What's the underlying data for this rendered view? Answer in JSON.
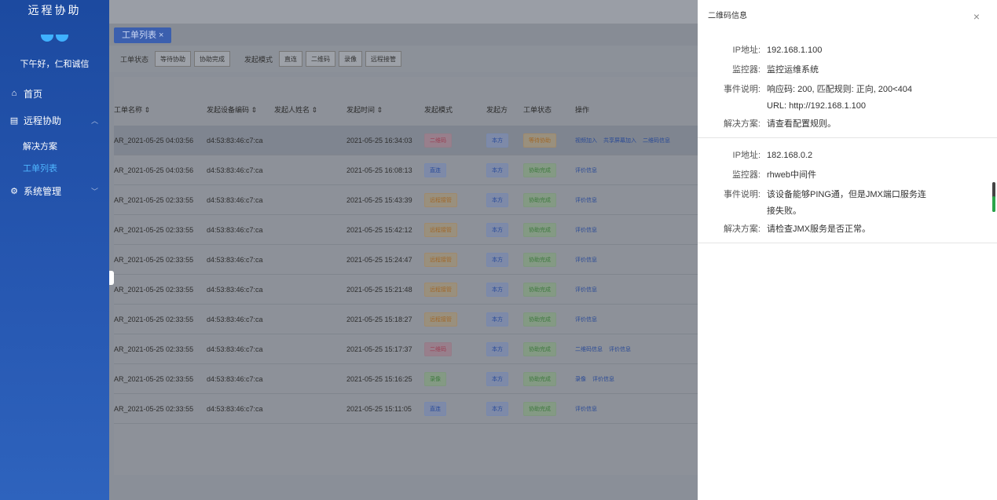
{
  "sidebar": {
    "brand": "远程协助",
    "greeting": "下午好，仁和诚信",
    "items": [
      {
        "label": "首页",
        "icon": "home-icon"
      },
      {
        "label": "远程协助",
        "icon": "clipboard-icon"
      },
      {
        "label": "系统管理",
        "icon": "gear-icon"
      }
    ],
    "subitems": [
      {
        "label": "解决方案"
      },
      {
        "label": "工单列表"
      }
    ]
  },
  "tab": {
    "label": "工单列表 ×"
  },
  "filters": {
    "status_label": "工单状态",
    "status_options": [
      "等待协助",
      "协助完成"
    ],
    "mode_label": "发起模式",
    "mode_options": [
      "直连",
      "二维码",
      "录像",
      "远程接管"
    ]
  },
  "table": {
    "headers": [
      "工单名称 ⇕",
      "发起设备编码 ⇕",
      "发起人姓名 ⇕",
      "发起时间 ⇕",
      "发起模式",
      "发起方",
      "工单状态",
      "操作"
    ],
    "rows": [
      {
        "name": "AR_2021-05-25 04:03:56",
        "device": "d4:53:83:46:c7:ca",
        "person": "",
        "time": "2021-05-25 16:34:03",
        "mode": "二维码",
        "mode_color": "red",
        "side": "本方",
        "status": "等待协助",
        "status_color": "orange",
        "ops": [
          "视频加入",
          "共享屏幕加入",
          "二维码信息"
        ]
      },
      {
        "name": "AR_2021-05-25 04:03:56",
        "device": "d4:53:83:46:c7:ca",
        "person": "",
        "time": "2021-05-25 16:08:13",
        "mode": "直连",
        "mode_color": "blue",
        "side": "本方",
        "status": "协助完成",
        "status_color": "green",
        "ops": [
          "评价信息"
        ]
      },
      {
        "name": "AR_2021-05-25 02:33:55",
        "device": "d4:53:83:46:c7:ca",
        "person": "",
        "time": "2021-05-25 15:43:39",
        "mode": "远程接管",
        "mode_color": "orange",
        "side": "本方",
        "status": "协助完成",
        "status_color": "green",
        "ops": [
          "评价信息"
        ]
      },
      {
        "name": "AR_2021-05-25 02:33:55",
        "device": "d4:53:83:46:c7:ca",
        "person": "",
        "time": "2021-05-25 15:42:12",
        "mode": "远程接管",
        "mode_color": "orange",
        "side": "本方",
        "status": "协助完成",
        "status_color": "green",
        "ops": [
          "评价信息"
        ]
      },
      {
        "name": "AR_2021-05-25 02:33:55",
        "device": "d4:53:83:46:c7:ca",
        "person": "",
        "time": "2021-05-25 15:24:47",
        "mode": "远程接管",
        "mode_color": "orange",
        "side": "本方",
        "status": "协助完成",
        "status_color": "green",
        "ops": [
          "评价信息"
        ]
      },
      {
        "name": "AR_2021-05-25 02:33:55",
        "device": "d4:53:83:46:c7:ca",
        "person": "",
        "time": "2021-05-25 15:21:48",
        "mode": "远程接管",
        "mode_color": "orange",
        "side": "本方",
        "status": "协助完成",
        "status_color": "green",
        "ops": [
          "评价信息"
        ]
      },
      {
        "name": "AR_2021-05-25 02:33:55",
        "device": "d4:53:83:46:c7:ca",
        "person": "",
        "time": "2021-05-25 15:18:27",
        "mode": "远程接管",
        "mode_color": "orange",
        "side": "本方",
        "status": "协助完成",
        "status_color": "green",
        "ops": [
          "评价信息"
        ]
      },
      {
        "name": "AR_2021-05-25 02:33:55",
        "device": "d4:53:83:46:c7:ca",
        "person": "",
        "time": "2021-05-25 15:17:37",
        "mode": "二维码",
        "mode_color": "red",
        "side": "本方",
        "status": "协助完成",
        "status_color": "green",
        "ops": [
          "二维码信息",
          "评价信息"
        ]
      },
      {
        "name": "AR_2021-05-25 02:33:55",
        "device": "d4:53:83:46:c7:ca",
        "person": "",
        "time": "2021-05-25 15:16:25",
        "mode": "录像",
        "mode_color": "green",
        "side": "本方",
        "status": "协助完成",
        "status_color": "green",
        "ops": [
          "录像",
          "评价信息"
        ]
      },
      {
        "name": "AR_2021-05-25 02:33:55",
        "device": "d4:53:83:46:c7:ca",
        "person": "",
        "time": "2021-05-25 15:11:05",
        "mode": "直连",
        "mode_color": "blue",
        "side": "本方",
        "status": "协助完成",
        "status_color": "green",
        "ops": [
          "评价信息"
        ]
      }
    ]
  },
  "drawer": {
    "title": "二维码信息",
    "close": "×",
    "blocks": [
      {
        "ip_label": "IP地址:",
        "ip": "192.168.1.100",
        "monitor_label": "监控器:",
        "monitor": "监控运维系统",
        "event_label": "事件说明:",
        "event": "响应码: 200, 匹配规则: 正向, 200<404 URL: http://192.168.1.100",
        "solution_label": "解决方案:",
        "solution": "请查看配置规则。"
      },
      {
        "ip_label": "IP地址:",
        "ip": "182.168.0.2",
        "monitor_label": "监控器:",
        "monitor": "rhweb中间件",
        "event_label": "事件说明:",
        "event": "该设备能够PING通，但是JMX端口服务连接失败。",
        "solution_label": "解决方案:",
        "solution": "请检查JMX服务是否正常。"
      }
    ]
  }
}
